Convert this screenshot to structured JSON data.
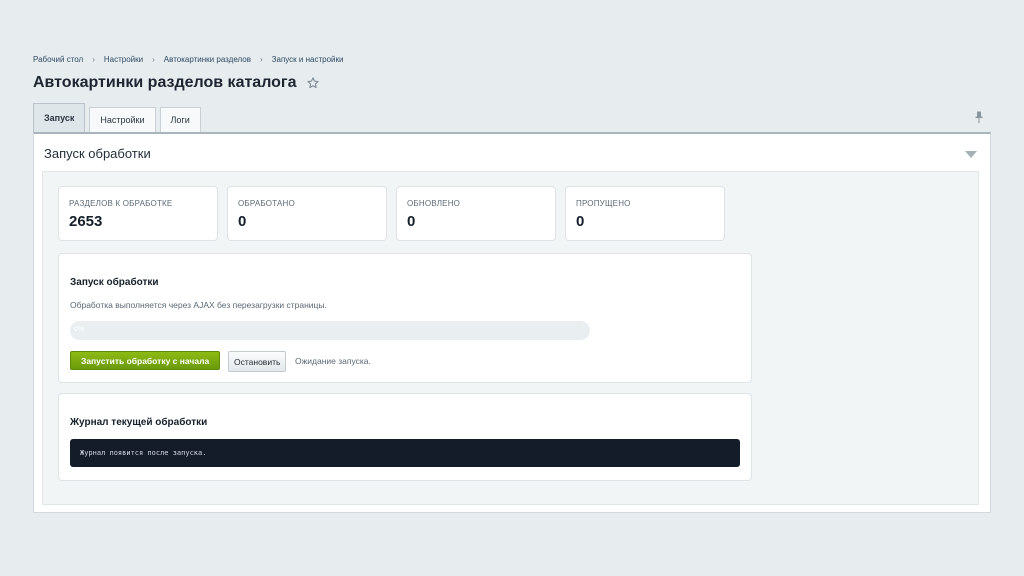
{
  "breadcrumb": [
    "Рабочий стол",
    "Настройки",
    "Автокартинки разделов",
    "Запуск и настройки"
  ],
  "breadcrumb_sep": "›",
  "page_title": "Автокартинки разделов каталога",
  "tabs": [
    {
      "label": "Запуск",
      "active": true
    },
    {
      "label": "Настройки",
      "active": false
    },
    {
      "label": "Логи",
      "active": false
    }
  ],
  "panel": {
    "title": "Запуск обработки"
  },
  "stats": [
    {
      "label": "Разделов к обработке",
      "value": "2653"
    },
    {
      "label": "Обработано",
      "value": "0"
    },
    {
      "label": "Обновлено",
      "value": "0"
    },
    {
      "label": "Пропущено",
      "value": "0"
    }
  ],
  "run_card": {
    "title": "Запуск обработки",
    "description": "Обработка выполняется через AJAX без перезагрузки страницы.",
    "progress_percent": 0,
    "progress_text": "0%",
    "start_button": "Запустить обработку с начала",
    "stop_button": "Остановить",
    "status": "Ожидание запуска."
  },
  "log_card": {
    "title": "Журнал текущей обработки",
    "log_text": "Журнал появится после запуска."
  },
  "colors": {
    "accent_green": "#7aab10",
    "log_bg": "#141b29"
  },
  "icons": {
    "favorite": "star-icon",
    "pin": "pin-icon",
    "collapse": "chevron-down-icon"
  }
}
